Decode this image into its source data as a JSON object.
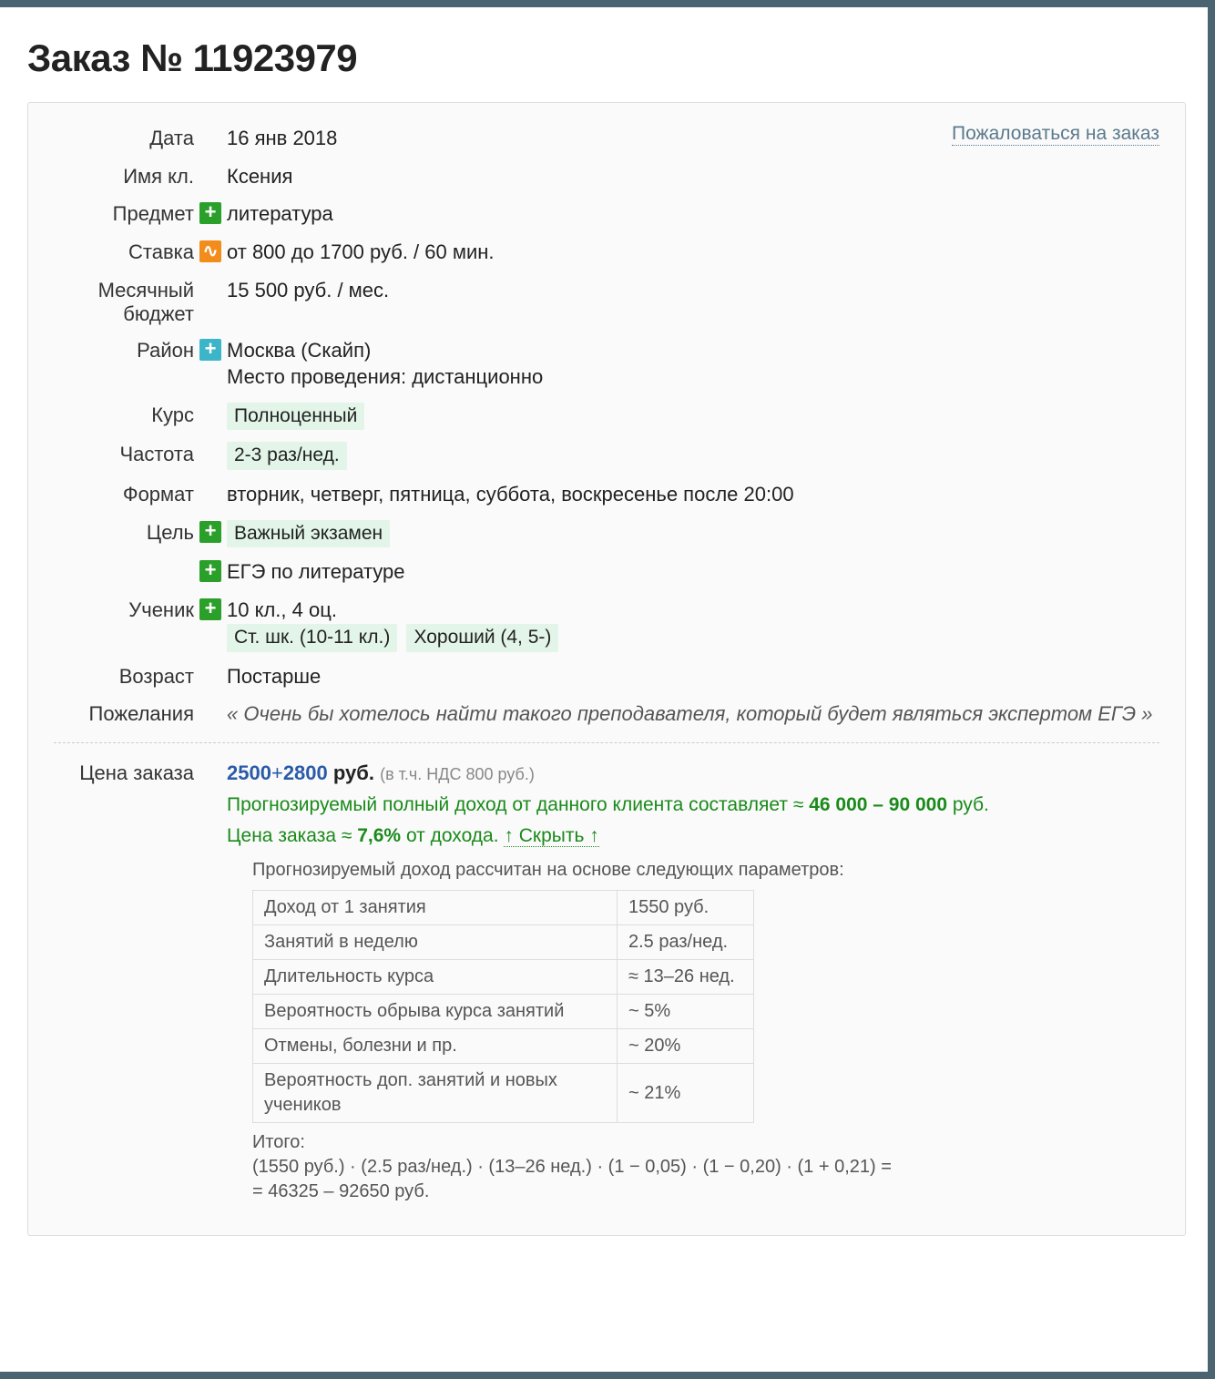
{
  "title": "Заказ № 11923979",
  "complain": "Пожаловаться на заказ",
  "fields": {
    "date": {
      "label": "Дата",
      "value": "16 янв 2018"
    },
    "name": {
      "label": "Имя кл.",
      "value": "Ксения"
    },
    "subject": {
      "label": "Предмет",
      "value": "литература"
    },
    "rate": {
      "label": "Ставка",
      "value": "от 800 до 1700 руб. / 60 мин."
    },
    "budget": {
      "label": "Месячный бюджет",
      "value": "15 500 руб. / мес."
    },
    "region": {
      "label": "Район",
      "value": "Москва (Скайп)",
      "sub": "Место проведения: дистанционно"
    },
    "course": {
      "label": "Курс",
      "tag": "Полноценный"
    },
    "frequency": {
      "label": "Частота",
      "tag": "2-3 раз/нед."
    },
    "format": {
      "label": "Формат",
      "value": "вторник, четверг, пятница, суббота, воскресенье после 20:00"
    },
    "goal": {
      "label": "Цель",
      "tag": "Важный экзамен",
      "sub_line": "ЕГЭ по литературе"
    },
    "student": {
      "label": "Ученик",
      "value": "10 кл., 4 оц.",
      "tag1": "Ст. шк. (10-11 кл.)",
      "tag2": "Хороший (4, 5-)"
    },
    "age": {
      "label": "Возраст",
      "value": "Постарше"
    },
    "wish": {
      "label": "Пожелания",
      "value": "« Очень бы хотелось найти такого преподавателя, который будет являться экспертом ЕГЭ »"
    }
  },
  "price": {
    "label": "Цена заказа",
    "a": "2500",
    "plus": "+",
    "b": "2800",
    "rub": "руб.",
    "vat": "(в т.ч. НДС 800 руб.)",
    "forecast1_pre": "Прогнозируемый полный доход от данного клиента составляет ≈ ",
    "forecast1_b": "46 000 – 90 000",
    "forecast1_post": " руб.",
    "forecast2_pre": "Цена заказа ≈ ",
    "forecast2_b": "7,6%",
    "forecast2_post": " от дохода. ",
    "hide": "↑ Скрыть ↑",
    "intro": "Прогнозируемый доход рассчитан на основе следующих параметров:",
    "params": [
      {
        "k": "Доход от 1 занятия",
        "v": "1550 руб."
      },
      {
        "k": "Занятий в неделю",
        "v": "2.5 раз/нед."
      },
      {
        "k": "Длительность курса",
        "v": "≈ 13–26 нед."
      },
      {
        "k": "Вероятность обрыва курса занятий",
        "v": "~ 5%"
      },
      {
        "k": "Отмены, болезни и пр.",
        "v": "~ 20%"
      },
      {
        "k": "Вероятность доп. занятий и новых учеников",
        "v": "~ 21%"
      }
    ],
    "total_label": "Итого:",
    "formula1": "(1550 руб.) · (2.5 раз/нед.) · (13–26 нед.) · (1 − 0,05) · (1 − 0,20) · (1 + 0,21) =",
    "formula2": "= 46325 – 92650 руб."
  }
}
